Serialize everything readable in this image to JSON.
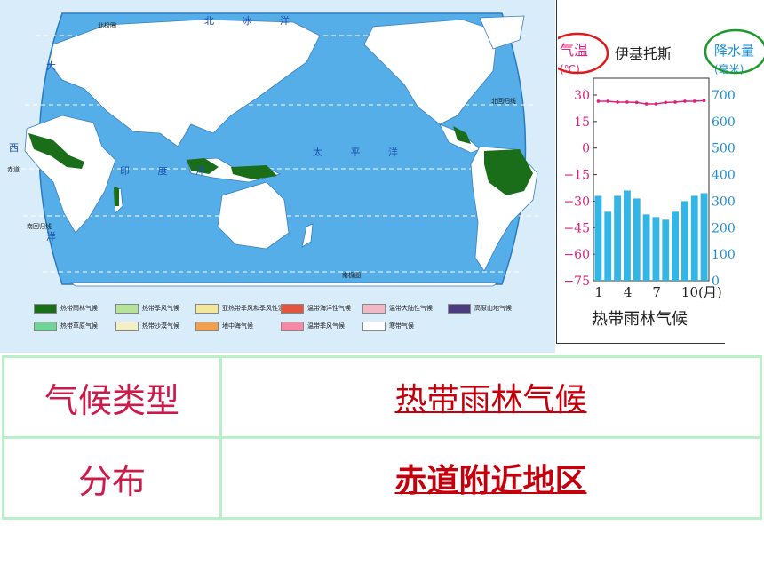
{
  "map": {
    "labels": {
      "arctic_ocean": "北 冰 洋",
      "atlantic": "大",
      "atlantic_2": "西",
      "atlantic_3": "洋",
      "indian_ocean": "印 度 洋",
      "pacific_ocean": "太 平 洋",
      "arctic_circle": "北极圈",
      "tropic_cancer": "北回归线",
      "equator": "赤道",
      "tropic_capricorn": "南回归线",
      "antarctic_circle": "南极圈"
    },
    "legend": [
      {
        "label": "热带雨林气候",
        "color": "#1a6e1a"
      },
      {
        "label": "热带季风气候",
        "color": "#b6e39a"
      },
      {
        "label": "亚热带季风和季风性湿润气候",
        "color": "#f5e79a"
      },
      {
        "label": "温带海洋性气候",
        "color": "#e0563f"
      },
      {
        "label": "温带大陆性气候",
        "color": "#f2b8c6"
      },
      {
        "label": "高原山地气候",
        "color": "#4a3c7e"
      },
      {
        "label": "热带草原气候",
        "color": "#6fd39a"
      },
      {
        "label": "热带沙漠气候",
        "color": "#f3f0c8"
      },
      {
        "label": "地中海气候",
        "color": "#f0a050"
      },
      {
        "label": "温带季风气候",
        "color": "#f58aa6"
      },
      {
        "label": "寒带气候",
        "color": "#ffffff"
      }
    ]
  },
  "climate_chart": {
    "station": "伊基托斯",
    "temp_label": "气温",
    "temp_unit": "(℃)",
    "precip_label": "降水量",
    "precip_unit": "(毫米)",
    "caption": "热带雨林气候",
    "temp_ticks": [
      "30",
      "15",
      "0",
      "−15",
      "−30",
      "−45",
      "−60",
      "−75"
    ],
    "precip_ticks": [
      "700",
      "600",
      "500",
      "400",
      "300",
      "200",
      "100",
      "0"
    ],
    "month_ticks": [
      "1",
      "4",
      "7",
      "10(月)"
    ],
    "temp_color": "#e0207a",
    "bar_color": "#33b5e5",
    "temperature_c": [
      26.5,
      26.5,
      26,
      26,
      25.8,
      25,
      25,
      25.8,
      26,
      26.5,
      26.5,
      26.8
    ],
    "precipitation_mm": [
      320,
      260,
      320,
      340,
      310,
      250,
      240,
      230,
      260,
      300,
      320,
      330
    ]
  },
  "table": {
    "row1_label": "气候类型",
    "row1_value": "热带雨林气候",
    "row2_label": "分布",
    "row2_value": "赤道附近地区"
  }
}
